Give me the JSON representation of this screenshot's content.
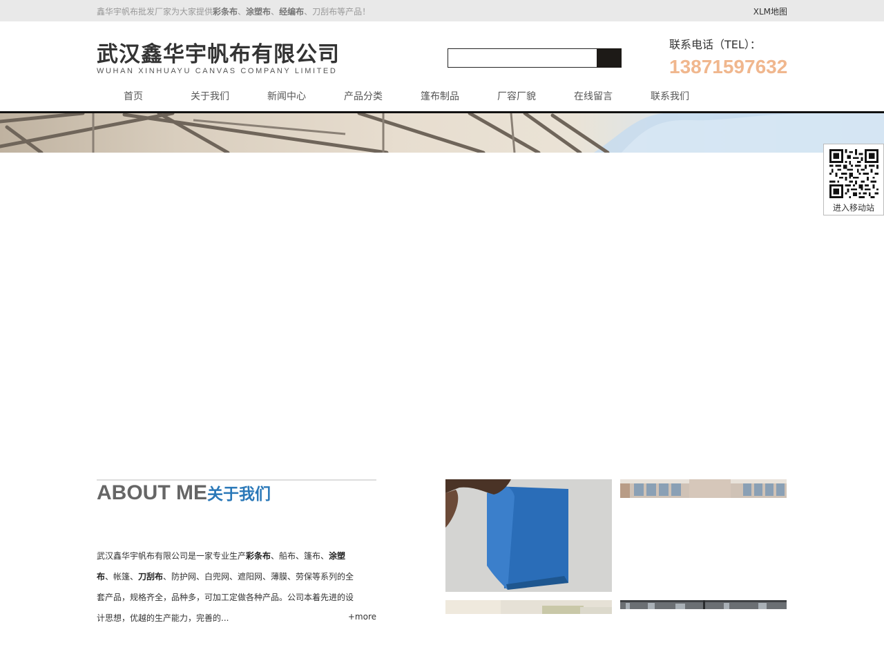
{
  "topbar": {
    "tagline_parts": [
      {
        "text": "鑫华宇帆布批发厂家为大家提供",
        "bold": false
      },
      {
        "text": "彩条布",
        "bold": true
      },
      {
        "text": "、",
        "bold": false
      },
      {
        "text": "涂塑布",
        "bold": true
      },
      {
        "text": "、",
        "bold": false
      },
      {
        "text": "经编布",
        "bold": true
      },
      {
        "text": "、刀刮布等产品！",
        "bold": false
      }
    ],
    "sitemap_label": "XLM地图"
  },
  "header": {
    "logo_cn": "武汉鑫华宇帆布有限公司",
    "logo_en": "WUHAN XINHUAYU CANVAS COMPANY LIMITED",
    "search_value": "",
    "tel_label": "联系电话（TEL）：",
    "tel_number": "13871597632"
  },
  "nav": {
    "items": [
      "首页",
      "关于我们",
      "新闻中心",
      "产品分类",
      "篷布制品",
      "厂容厂貌",
      "在线留言",
      "联系我们"
    ]
  },
  "qr": {
    "label": "进入移动站"
  },
  "about": {
    "heading_en": "ABOUT ME",
    "heading_cn": "关于我们",
    "description_parts": [
      {
        "text": "武汉鑫华宇帆布有限公司是一家专业生产",
        "bold": false
      },
      {
        "text": "彩条布",
        "bold": true
      },
      {
        "text": "、船布、篷布、",
        "bold": false
      },
      {
        "text": "涂塑布",
        "bold": true
      },
      {
        "text": "、帐篷、",
        "bold": false
      },
      {
        "text": "刀刮布",
        "bold": true
      },
      {
        "text": "、防护网、白兜网、遮阳网、薄膜、劳保等系列的全套产品，规格齐全，品种多，可加工定做各种产品。公司本着先进的设计思想，优越的生产能力，完善的...",
        "bold": false
      }
    ],
    "more_label": "+more"
  },
  "colors": {
    "topbar_bg": "#e9e9e9",
    "tel_number": "#f0b78e",
    "about_heading_cn": "#2a78b8",
    "nav_underline": "#111111"
  }
}
